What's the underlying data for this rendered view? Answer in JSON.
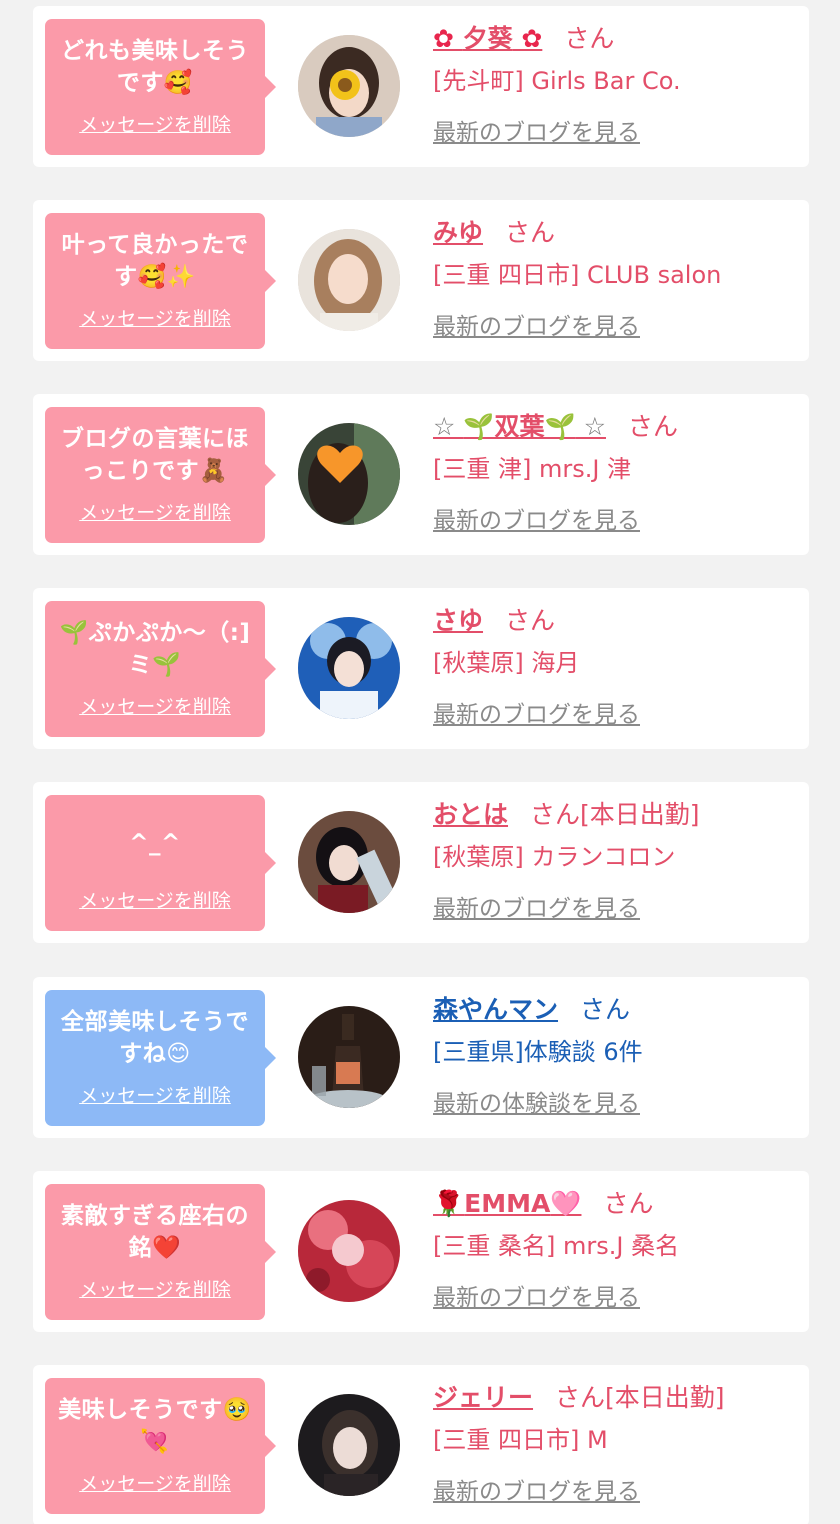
{
  "delete_label": "メッセージを削除",
  "san_label": "さん",
  "entries": [
    {
      "message": "どれも美味しそう\nです🥰",
      "name_prefix": "✿ ",
      "name": "夕葵",
      "name_suffix": " ✿",
      "status": "",
      "shop": "[先斗町] Girls Bar Co.",
      "link": "最新のブログを見る",
      "bubble_color": "#fb9aa9"
    },
    {
      "message": "叶って良かったで\nす🥰✨",
      "name_prefix": "",
      "name": "みゆ",
      "name_suffix": "",
      "status": "",
      "shop": "[三重 四日市] CLUB salon",
      "link": "最新のブログを見る",
      "bubble_color": "#fb9aa9"
    },
    {
      "message": "ブログの言葉にほ\nっこりです🧸",
      "name_prefix": "☆ ",
      "name": "🌱双葉🌱",
      "name_suffix": " ☆",
      "status": "",
      "shop": "[三重 津] mrs.J 津",
      "link": "最新のブログを見る",
      "bubble_color": "#fb9aa9"
    },
    {
      "message": "🌱ぷかぷか〜（:]\nミ🌱",
      "name_prefix": "",
      "name": "さゆ",
      "name_suffix": "",
      "status": "",
      "shop": "[秋葉原] 海月",
      "link": "最新のブログを見る",
      "bubble_color": "#fb9aa9"
    },
    {
      "message": "^_^",
      "name_prefix": "",
      "name": "おとは",
      "name_suffix": "",
      "status": "[本日出勤]",
      "shop": "[秋葉原] カランコロン",
      "link": "最新のブログを見る",
      "bubble_color": "#fb9aa9"
    },
    {
      "message": "全部美味しそうで\nすね😊",
      "name_prefix": "",
      "name": "森やんマン",
      "name_suffix": "",
      "status": "",
      "shop": "[三重県]体験談 6件",
      "link": "最新の体験談を見る",
      "bubble_color": "#8db9f6"
    },
    {
      "message": "素敵すぎる座右の\n銘❤️",
      "name_prefix": "🌹",
      "name": "EMMA",
      "name_suffix": "🩷",
      "status": "",
      "shop": "[三重 桑名] mrs.J 桑名",
      "link": "最新のブログを見る",
      "bubble_color": "#fb9aa9"
    },
    {
      "message": "美味しそうです🥹\n💘",
      "name_prefix": "",
      "name": "ジェリー",
      "name_suffix": "",
      "status": "[本日出勤]",
      "shop": "[三重 四日市] M",
      "link": "最新のブログを見る",
      "bubble_color": "#fb9aa9"
    }
  ]
}
